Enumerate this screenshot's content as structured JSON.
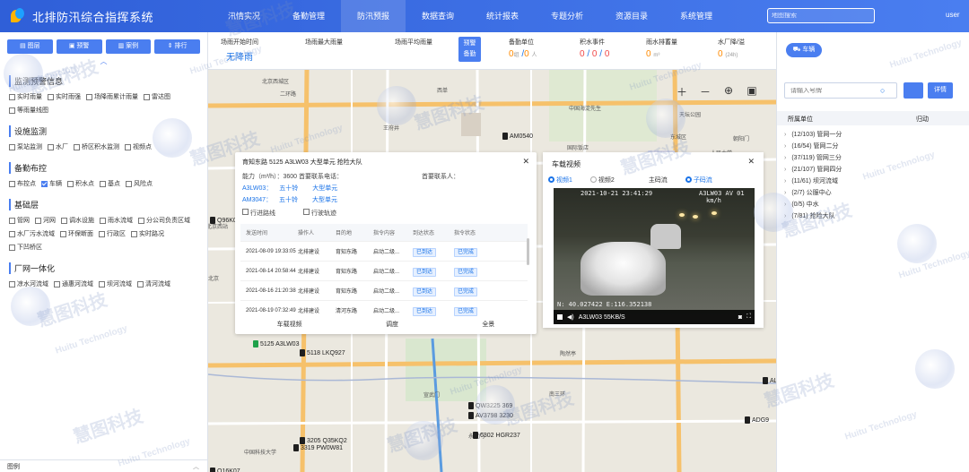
{
  "app": {
    "title": "北排防汛综合指挥系统",
    "user": "user"
  },
  "nav": [
    "汛情实况",
    "备勤管理",
    "防汛预报",
    "数据查询",
    "统计报表",
    "专题分析",
    "资源目录",
    "系统管理"
  ],
  "nav_active": 2,
  "top_search": {
    "placeholder": "地图搜索"
  },
  "left_tabs": [
    "图层",
    "预警",
    "案例",
    "排行"
  ],
  "sections": [
    {
      "title": "监测预警信息",
      "options": [
        {
          "label": "实时雨量",
          "checked": false
        },
        {
          "label": "实时雨强",
          "checked": false
        },
        {
          "label": "场降雨累计雨量",
          "checked": false
        },
        {
          "label": "雷达图",
          "checked": false
        },
        {
          "label": "等雨量线图",
          "checked": false
        }
      ]
    },
    {
      "title": "设施监测",
      "options": [
        {
          "label": "泵站监测",
          "checked": false
        },
        {
          "label": "水厂",
          "checked": false
        },
        {
          "label": "桥区积水监测",
          "checked": false
        },
        {
          "label": "视频点",
          "checked": false
        }
      ]
    },
    {
      "title": "备勤布控",
      "options": [
        {
          "label": "布控点",
          "checked": false
        },
        {
          "label": "车辆",
          "checked": true
        },
        {
          "label": "积水点",
          "checked": false
        },
        {
          "label": "基点",
          "checked": false
        },
        {
          "label": "风险点",
          "checked": false
        }
      ]
    },
    {
      "title": "基础层",
      "options": [
        {
          "label": "管网",
          "checked": false
        },
        {
          "label": "河网",
          "checked": false
        },
        {
          "label": "调水设施",
          "checked": false
        },
        {
          "label": "雨水流域",
          "checked": false
        },
        {
          "label": "分公司负责区域",
          "checked": false
        },
        {
          "label": "水厂污水流域",
          "checked": false
        },
        {
          "label": "环保断面",
          "checked": false
        },
        {
          "label": "行政区",
          "checked": false
        },
        {
          "label": "实时路况",
          "checked": false
        },
        {
          "label": "下凹桥区",
          "checked": false
        }
      ]
    },
    {
      "title": "厂网一体化",
      "options": [
        {
          "label": "凉水河流域",
          "checked": false
        },
        {
          "label": "通惠河流域",
          "checked": false
        },
        {
          "label": "坝河流域",
          "checked": false
        },
        {
          "label": "清河流域",
          "checked": false
        }
      ]
    }
  ],
  "legend_label": "图例",
  "stats": {
    "rain_start_label": "场雨开始时间",
    "rain_start_value": "无降雨",
    "max_rain_label": "场雨最大雨量",
    "avg_rain_label": "场雨平均雨量",
    "warn_btn": [
      "预警",
      "备勤"
    ],
    "standby_label": "备勤单位",
    "standby_units": "0",
    "standby_unit_suffix": "组",
    "standby_people": "0",
    "standby_people_suffix": "人",
    "ponding_label": "积水事件",
    "ponding_values": [
      "0",
      "0",
      "0"
    ],
    "drain_label": "雨水排蓄量",
    "drain_value": "0",
    "drain_unit": "m³",
    "water_label": "水厂降/溢",
    "water_value": "0",
    "water_unit": "(24h)"
  },
  "map": {
    "labels": [
      "北京西城区",
      "二环路",
      "西单",
      "北京西站",
      "王府井",
      "中国海淀先生",
      "国际饭店",
      "东城区",
      "朝阳门",
      "人民大学",
      "天坛公园",
      "陶然亭",
      "南三环",
      "中国科技大学",
      "永定门",
      "宣武门",
      "北京",
      "前门"
    ],
    "markers": [
      {
        "label": "AM0540",
        "color": "black"
      },
      {
        "label": "5125 A3LW03",
        "color": "green"
      },
      {
        "label": "5118 LKQ927",
        "color": "black"
      },
      {
        "label": "QW3225 369",
        "color": "black"
      },
      {
        "label": "AV3798 3230",
        "color": "black"
      },
      {
        "label": "6302 HGR237",
        "color": "black"
      },
      {
        "label": "3205 Q35KQ2",
        "color": "black"
      },
      {
        "label": "3319 PW0W81",
        "color": "black"
      },
      {
        "label": "Q16K07",
        "color": "black"
      },
      {
        "label": "AL",
        "color": "black"
      },
      {
        "label": "ADG9",
        "color": "black"
      },
      {
        "label": "Q96K0",
        "color": "black"
      }
    ]
  },
  "task_popup": {
    "title": "育知东路 5125 A3LW03 大型单元 抢险大队",
    "capacity": "能力（m³/h）：3600 首要联系电话：",
    "contact": "首要联系人：",
    "vehicles": [
      {
        "code": "A3LW03：",
        "status": "五十铃",
        "type": "大型单元"
      },
      {
        "code": "AM3047：",
        "status": "五十铃",
        "type": "大型单元"
      }
    ],
    "checks": [
      "行进路线",
      "行驶轨迹"
    ],
    "headers": [
      "发送时间",
      "操作人",
      "目的地",
      "指令内容",
      "到达状态",
      "指令状态"
    ],
    "rows": [
      [
        "2021-08-09 19:33:05",
        "北排建设",
        "育知东路",
        "启动二级...",
        "已到达",
        "已完成"
      ],
      [
        "2021-08-14 20:58:44",
        "北排建设",
        "育知东路",
        "启动二级...",
        "已到达",
        "已完成"
      ],
      [
        "2021-08-16 21:20:38",
        "北排建设",
        "育知东路",
        "启动二级...",
        "已到达",
        "已完成"
      ],
      [
        "2021-08-19 07:32:49",
        "北排建设",
        "清河东路",
        "启动二级...",
        "已到达",
        "已完成"
      ]
    ],
    "footer": [
      "车载视频",
      "调度",
      "全景"
    ]
  },
  "video_popup": {
    "title": "车载视频",
    "radios": [
      "视频1",
      "视频2",
      "主码流",
      "子码流"
    ],
    "radio_on": [
      0,
      3
    ],
    "osd_time": "2021-10-21 23:41:29",
    "osd_plate": "A3LW03 AV 01",
    "osd_speed": "km/h",
    "osd_coords": "N: 40.027422 E:116.352138",
    "status": "A3LW03 55KB/S"
  },
  "right": {
    "tab": "车辆",
    "search_placeholder": "请输入号牌",
    "detail_btn": "详情",
    "headers": [
      "所属单位",
      "归动"
    ],
    "tree": [
      "(12/103) 管网一分",
      "(16/54) 管网二分",
      "(37/119) 管网三分",
      "(21/107) 管网四分",
      "(11/61) 坝河流域",
      "(2/7) 公服中心",
      "(0/5) 中水",
      "(7/81) 抢险大队"
    ]
  },
  "watermark": {
    "cn": "慧图科技",
    "en": "Huitu Technology"
  }
}
